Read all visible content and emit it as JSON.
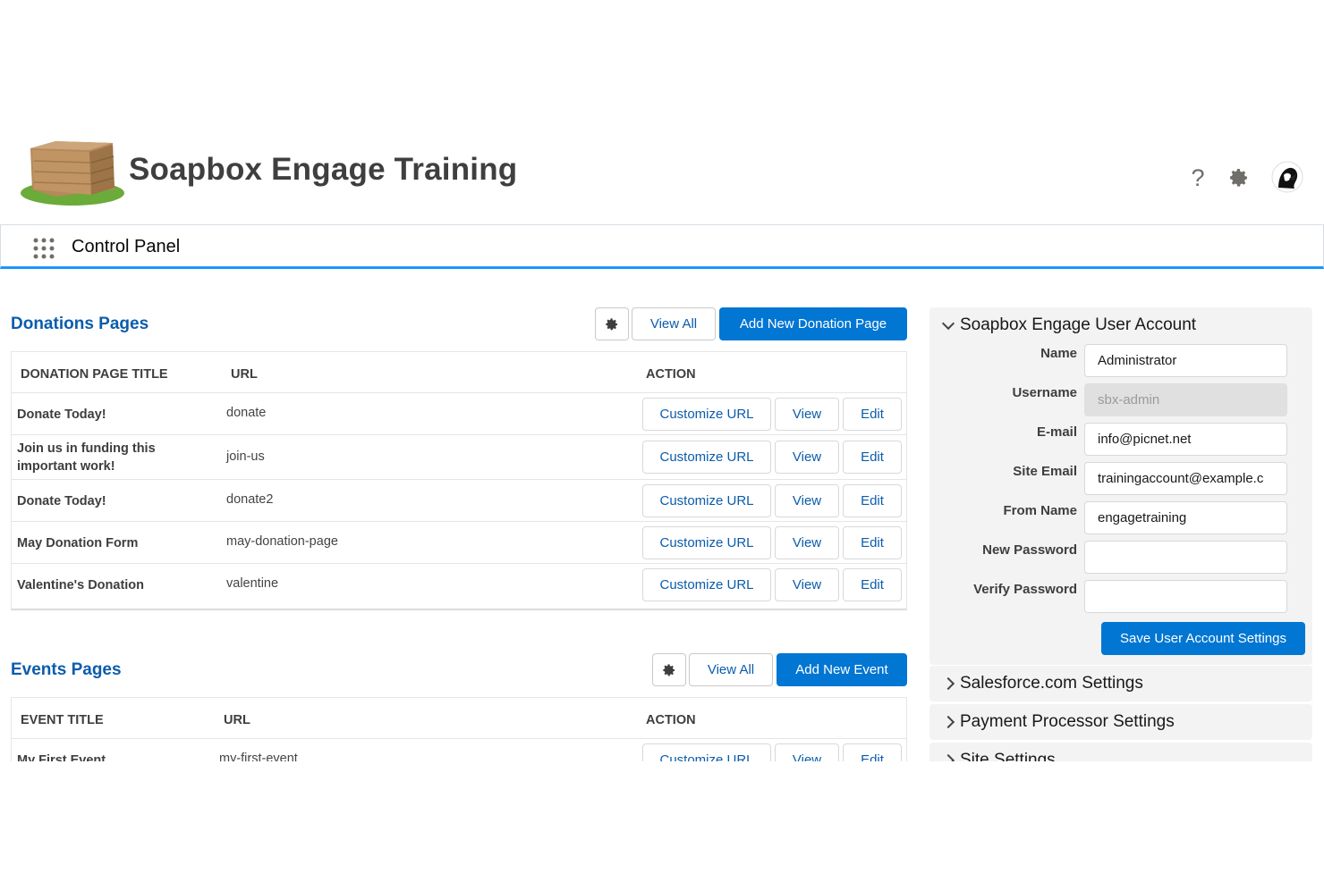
{
  "header": {
    "app_title": "Soapbox Engage Training",
    "help_glyph": "?",
    "icons": [
      "crate-logo",
      "help-icon",
      "gear-icon",
      "avatar"
    ]
  },
  "nav": {
    "title": "Control Panel"
  },
  "donations": {
    "title": "Donations Pages",
    "view_all": "View All",
    "add_new": "Add New Donation Page",
    "columns": [
      "DONATION PAGE TITLE",
      "URL",
      "ACTION"
    ],
    "rows": [
      {
        "title": "Donate Today!",
        "url": "donate"
      },
      {
        "title": "Join us in funding this important work!",
        "url": "join-us"
      },
      {
        "title": "Donate Today!",
        "url": "donate2"
      },
      {
        "title": "May Donation Form",
        "url": "may-donation-page"
      },
      {
        "title": "Valentine's Donation",
        "url": "valentine"
      }
    ],
    "actions": {
      "customize": "Customize URL",
      "view": "View",
      "edit": "Edit"
    }
  },
  "events": {
    "title": "Events Pages",
    "view_all": "View All",
    "add_new": "Add New Event",
    "columns": [
      "EVENT TITLE",
      "URL",
      "ACTION"
    ],
    "rows": [
      {
        "title": "My First Event",
        "url": "my-first-event"
      }
    ],
    "actions": {
      "customize": "Customize URL",
      "view": "View",
      "edit": "Edit"
    }
  },
  "account": {
    "title": "Soapbox Engage User Account",
    "fields": [
      {
        "label": "Name",
        "value": "Administrator"
      },
      {
        "label": "Username",
        "value": "sbx-admin"
      },
      {
        "label": "E-mail",
        "value": "info@picnet.net"
      },
      {
        "label": "Site Email",
        "value": "trainingaccount@example.c"
      },
      {
        "label": "From Name",
        "value": "engagetraining"
      },
      {
        "label": "New Password",
        "value": ""
      },
      {
        "label": "Verify Password",
        "value": ""
      }
    ],
    "save": "Save User Account Settings"
  },
  "accordions": [
    {
      "label": "Salesforce.com Settings"
    },
    {
      "label": "Payment Processor Settings"
    },
    {
      "label": "Site Settings"
    }
  ],
  "colors": {
    "brand": "#0176d3",
    "link": "#0b5cab",
    "nav_accent": "#1b96ff"
  }
}
